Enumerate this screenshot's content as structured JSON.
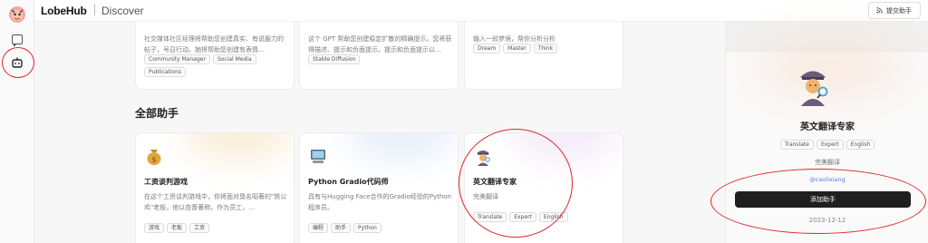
{
  "app": {
    "brand": "LobeHub",
    "section": "Discover",
    "submit_label": "提交助手"
  },
  "rail": {
    "icons": [
      "logo-icon",
      "chat-icon",
      "robot-icon"
    ]
  },
  "top_cards": [
    {
      "description": "社交媒体社区经理将帮助您创建真实、有说服力的帖子，号召行动。她将帮助您创建有表情…",
      "tags": [
        "Community Manager",
        "Social Media",
        "Publications"
      ]
    },
    {
      "description": "这个 GPT 帮助您创建稳定扩散的精确提示。您将获得描述、提示和负面提示。提示和负面提示以…",
      "tags": [
        "Stable Diffusion"
      ]
    },
    {
      "description": "输入一段梦境，帮你分析分析",
      "tags": [
        "Dream",
        "Master",
        "Think"
      ]
    }
  ],
  "all_section_title": "全部助手",
  "all_cards": [
    {
      "title": "工资谈判游戏",
      "description": "在这个工资谈判游戏中，你将面对臭名昭著的\"铁公鸡\"老板，他以吝啬著称。作为员工，…",
      "tags": [
        "游戏",
        "老板",
        "工资"
      ]
    },
    {
      "title": "Python Gradio代码师",
      "description": "具有与Hugging Face合作的Gradio经验的Python程序员。",
      "tags": [
        "编程",
        "助手",
        "Python"
      ]
    },
    {
      "title": "英文翻译专家",
      "description": "完美翻译",
      "tags": [
        "Translate",
        "Expert",
        "English"
      ]
    }
  ],
  "panel": {
    "title": "英文翻译专家",
    "tags": [
      "Translate",
      "Expert",
      "English"
    ],
    "description": "完美翻译",
    "author": "@caolixiang",
    "add_label": "添加助手",
    "date": "2023-12-12"
  },
  "colors": {
    "accent_dark": "#1f1f1f",
    "annotation_red": "#e0252b",
    "author_link": "#4a7fd6"
  }
}
